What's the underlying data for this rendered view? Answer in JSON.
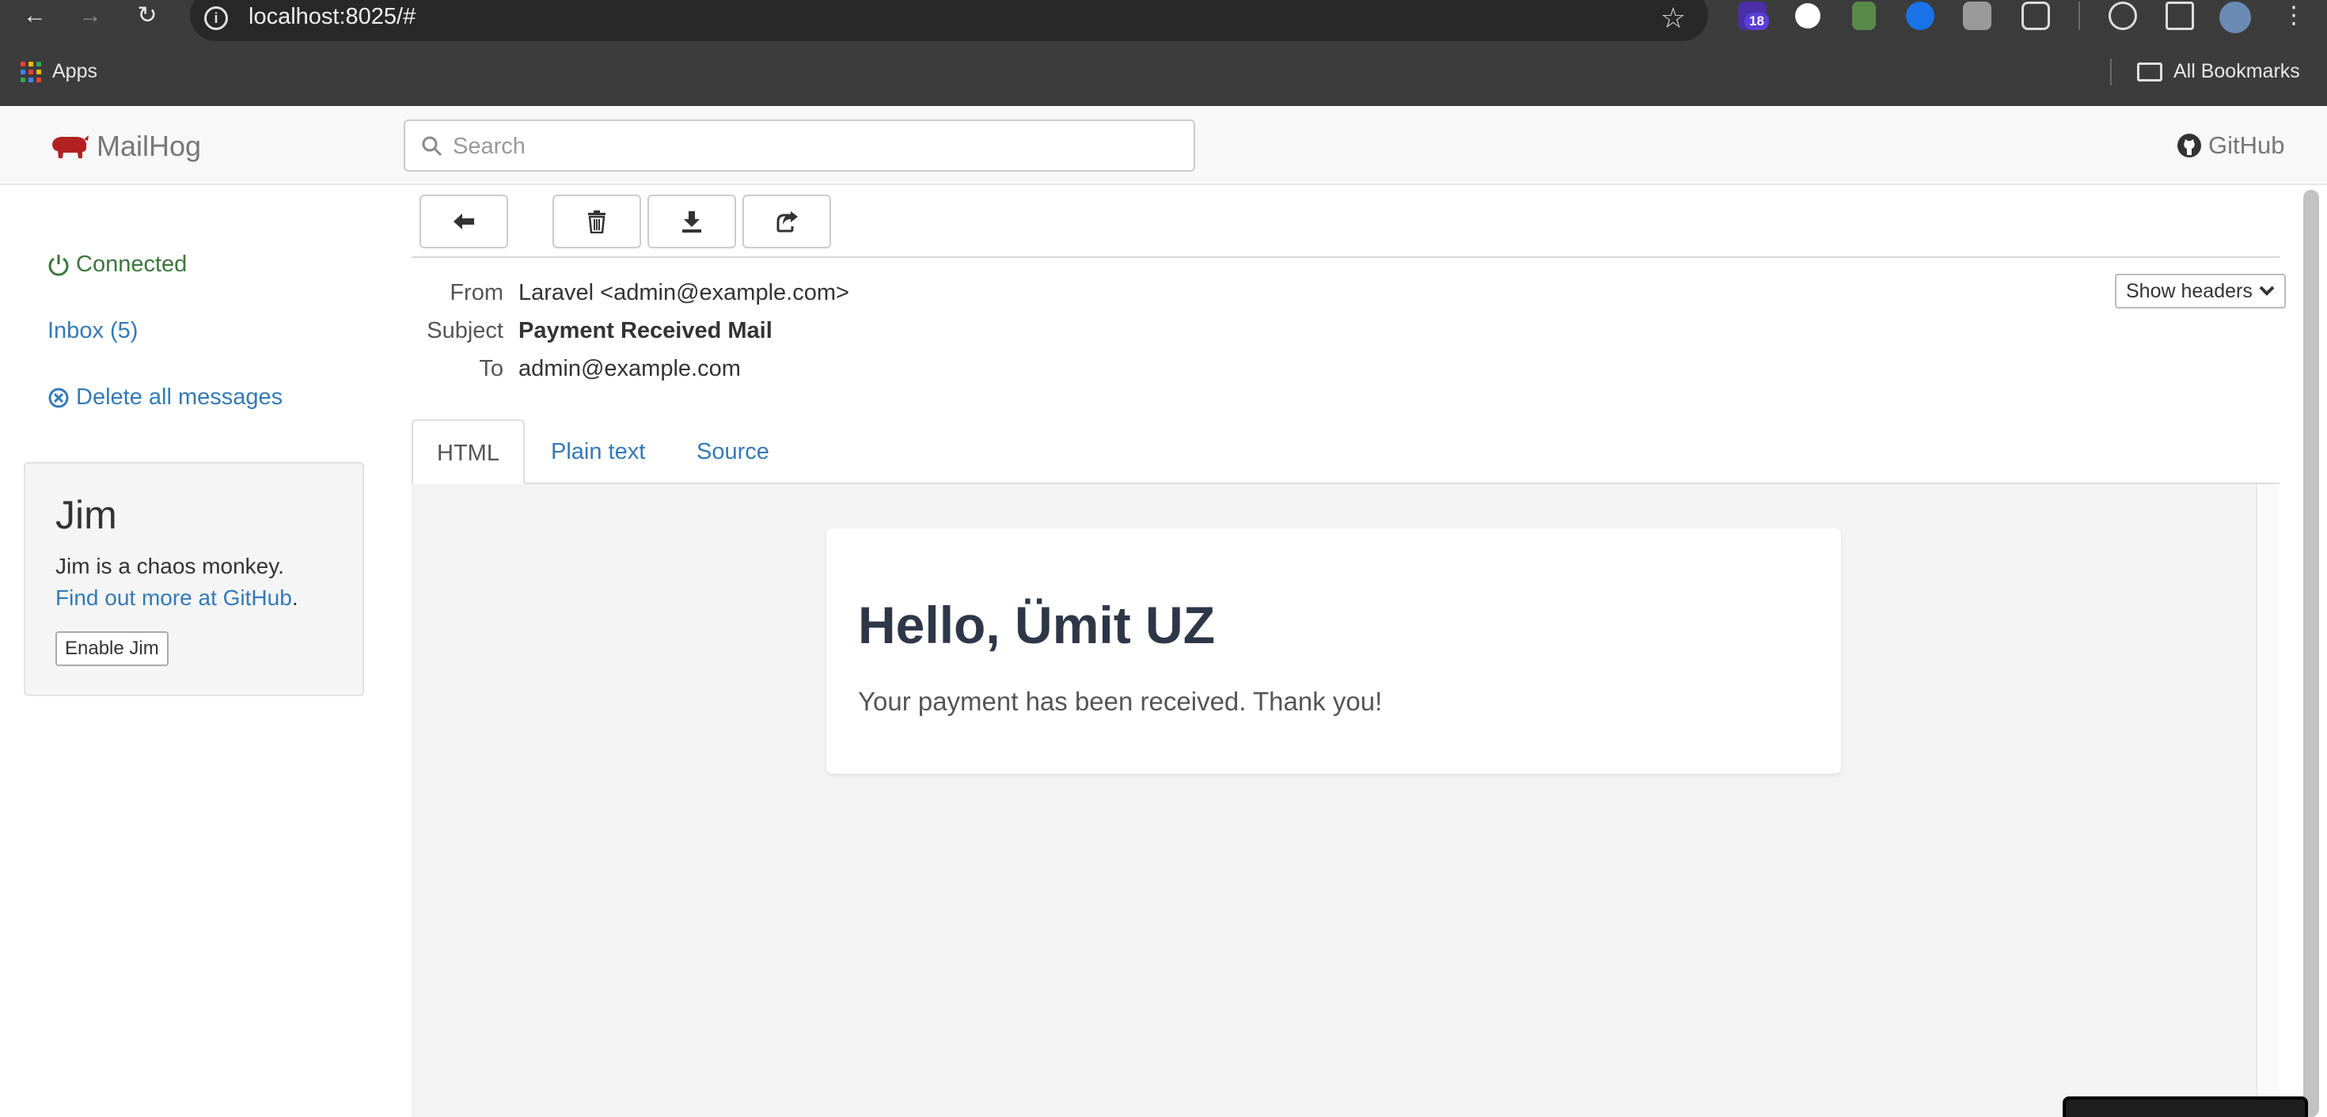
{
  "browser": {
    "url": "localhost:8025/#",
    "extension_badge": "18",
    "bookmarks": {
      "apps_label": "Apps",
      "all_bookmarks_label": "All Bookmarks"
    }
  },
  "header": {
    "brand": "MailHog",
    "search_placeholder": "Search",
    "github_label": "GitHub"
  },
  "sidebar": {
    "connected_label": "Connected",
    "inbox_label": "Inbox (5)",
    "delete_all_label": "Delete all messages",
    "jim": {
      "title": "Jim",
      "description": "Jim is a chaos monkey.",
      "link_text": "Find out more at GitHub",
      "link_suffix": ".",
      "button_label": "Enable Jim"
    }
  },
  "message": {
    "from_label": "From",
    "from_value": "Laravel <admin@example.com>",
    "subject_label": "Subject",
    "subject_value": "Payment Received Mail",
    "to_label": "To",
    "to_value": "admin@example.com",
    "show_headers_label": "Show headers"
  },
  "tabs": [
    {
      "label": "HTML",
      "active": true
    },
    {
      "label": "Plain text",
      "active": false
    },
    {
      "label": "Source",
      "active": false
    }
  ],
  "email_body": {
    "heading": "Hello, Ümit UZ",
    "text": "Your payment has been received. Thank you!"
  },
  "colors": {
    "link": "#337ab7",
    "connected": "#3c763d",
    "brand_pig": "#b22222",
    "chrome_bg": "#3c3c3c"
  }
}
